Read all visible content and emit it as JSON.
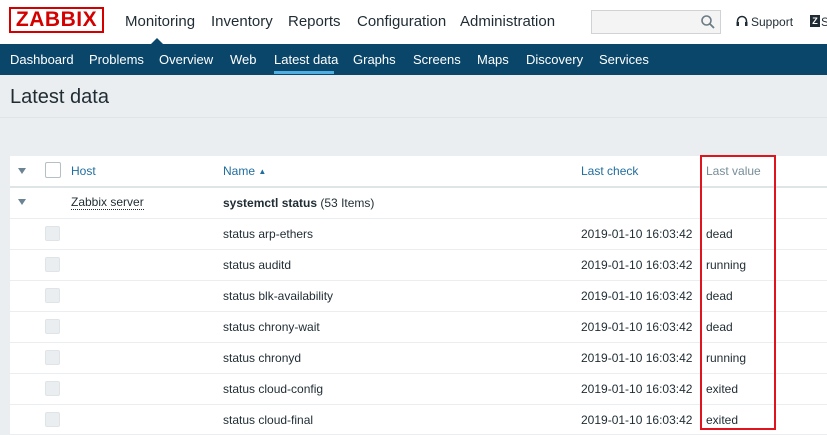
{
  "header": {
    "logo": "ZABBIX",
    "nav": [
      "Monitoring",
      "Inventory",
      "Reports",
      "Configuration",
      "Administration"
    ],
    "active_nav": "Monitoring",
    "search_placeholder": "",
    "support_label": "Support",
    "share_label": "S"
  },
  "subnav": {
    "items": [
      "Dashboard",
      "Problems",
      "Overview",
      "Web",
      "Latest data",
      "Graphs",
      "Screens",
      "Maps",
      "Discovery",
      "Services"
    ],
    "active": "Latest data"
  },
  "page": {
    "title": "Latest data"
  },
  "table": {
    "columns": {
      "host": "Host",
      "name": "Name",
      "last_check": "Last check",
      "last_value": "Last value"
    },
    "group": {
      "host": "Zabbix server",
      "app": "systemctl status",
      "count": "(53 Items)"
    },
    "rows": [
      {
        "name": "status arp-ethers",
        "last_check": "2019-01-10 16:03:42",
        "last_value": "dead"
      },
      {
        "name": "status auditd",
        "last_check": "2019-01-10 16:03:42",
        "last_value": "running"
      },
      {
        "name": "status blk-availability",
        "last_check": "2019-01-10 16:03:42",
        "last_value": "dead"
      },
      {
        "name": "status chrony-wait",
        "last_check": "2019-01-10 16:03:42",
        "last_value": "dead"
      },
      {
        "name": "status chronyd",
        "last_check": "2019-01-10 16:03:42",
        "last_value": "running"
      },
      {
        "name": "status cloud-config",
        "last_check": "2019-01-10 16:03:42",
        "last_value": "exited"
      },
      {
        "name": "status cloud-final",
        "last_check": "2019-01-10 16:03:42",
        "last_value": "exited"
      }
    ]
  },
  "colors": {
    "brand": "#d40000",
    "nav_bg": "#0a466a",
    "active_underline": "#4faee2",
    "link": "#1f6e9e",
    "highlight": "#e0141e"
  }
}
